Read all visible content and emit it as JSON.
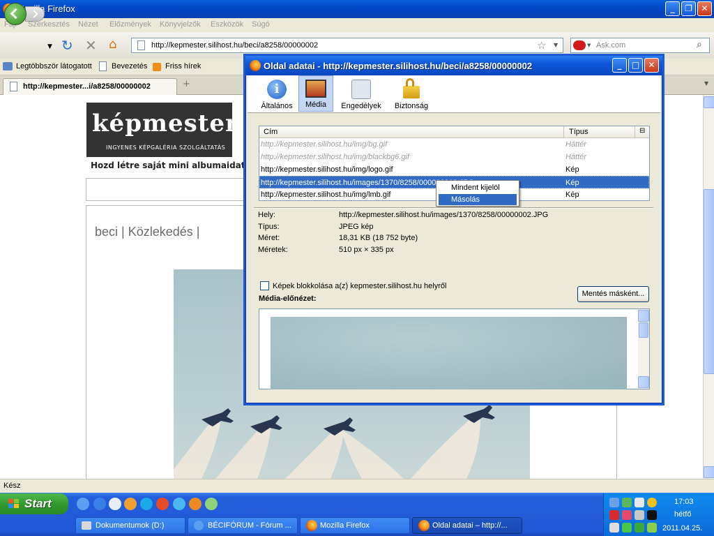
{
  "browser": {
    "title": "Mozilla Firefox",
    "menu": [
      "Fájl",
      "Szerkesztés",
      "Nézet",
      "Előzmények",
      "Könyvjelzők",
      "Eszközök",
      "Súgó"
    ],
    "url": "http://kepmester.silihost.hu/beci/a8258/00000002",
    "search_placeholder": "Ask.com",
    "bookmarks": [
      "Legtöbbször látogatott",
      "Bevezetés",
      "Friss hírek"
    ],
    "tab_title": "http://kepmester...i/a8258/00000002",
    "tab_new": "+",
    "status": "Kész"
  },
  "page": {
    "logo_main": "képmester",
    "logo_tagline": "INGYENES KÉPGALÉRIA SZOLGÁLTATÁS",
    "slogan": "Hozd létre saját mini albumaidat n",
    "breadcrumb": "beci | Közlekedés |"
  },
  "dialog": {
    "title": "Oldal adatai - http://kepmester.silihost.hu/beci/a8258/00000002",
    "tabs": [
      {
        "label": "Általános"
      },
      {
        "label": "Média"
      },
      {
        "label": "Engedélyek"
      },
      {
        "label": "Biztonság"
      }
    ],
    "columns": {
      "title": "Cím",
      "type": "Típus"
    },
    "rows": [
      {
        "address": "http://kepmester.silihost.hu/img/bg.gif",
        "type": "Háttér"
      },
      {
        "address": "http://kepmester.silihost.hu/img/blackbg6.gif",
        "type": "Háttér"
      },
      {
        "address": "http://kepmester.silihost.hu/img/logo.gif",
        "type": "Kép"
      },
      {
        "address": "http://kepmester.silihost.hu/images/1370/8258/000000002.JPG",
        "type": "Kép"
      },
      {
        "address": "http://kepmester.silihost.hu/img/lmb.gif",
        "type": "Kép"
      }
    ],
    "context_menu": [
      "Mindent kijelöl",
      "Másolás"
    ],
    "info": {
      "location_label": "Hely:",
      "location": "http://kepmester.silihost.hu/images/1370/8258/00000002.JPG",
      "type_label": "Típus:",
      "type": "JPEG kép",
      "size_label": "Méret:",
      "size": "18,31 KB (18 752 byte)",
      "dimensions_label": "Méretek:",
      "dimensions": "510 px × 335 px"
    },
    "block_label": "Képek blokkolása a(z) kepmester.silihost.hu helyről",
    "save_button": "Mentés másként...",
    "preview_label": "Média-előnézet:"
  },
  "taskbar": {
    "start": "Start",
    "tasks": [
      "Dokumentumok (D:)",
      "BÉCIFÓRUM - Fórum ...",
      "Mozilla Firefox",
      "Oldal adatai – http://..."
    ],
    "clock": "17:03",
    "day": "hétfő",
    "date": "2011.04.25."
  },
  "colors": {
    "selection": "#316ac5",
    "xp_blue": "#245edb",
    "start_green": "#2f962c"
  }
}
